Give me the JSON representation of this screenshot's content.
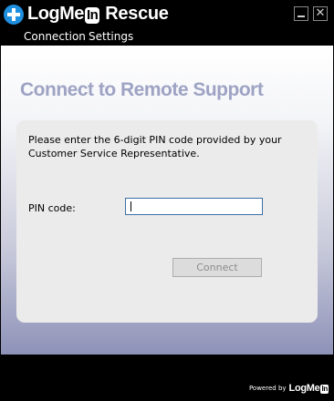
{
  "titlebar": {
    "logo": {
      "name": "LogMe",
      "in_badge": "In",
      "product": "Rescue",
      "plus_icon": "plus-circle-icon",
      "accent_color": "#1f8fe0"
    },
    "minimize_icon": "minimize-icon",
    "close_icon": "close-icon",
    "close_glyph": "✕"
  },
  "menu": {
    "items": [
      {
        "label": "Connection"
      },
      {
        "label": "Settings"
      }
    ]
  },
  "main": {
    "heading": "Connect to Remote Support",
    "instructions": "Please enter the 6-digit PIN code provided by your Customer Service Representative.",
    "pin_label": "PIN code:",
    "pin_value": "",
    "connect_label": "Connect",
    "connect_enabled": false
  },
  "footer": {
    "powered_text": "Powered by",
    "powered_logo": "LogMe",
    "powered_in": "In"
  }
}
